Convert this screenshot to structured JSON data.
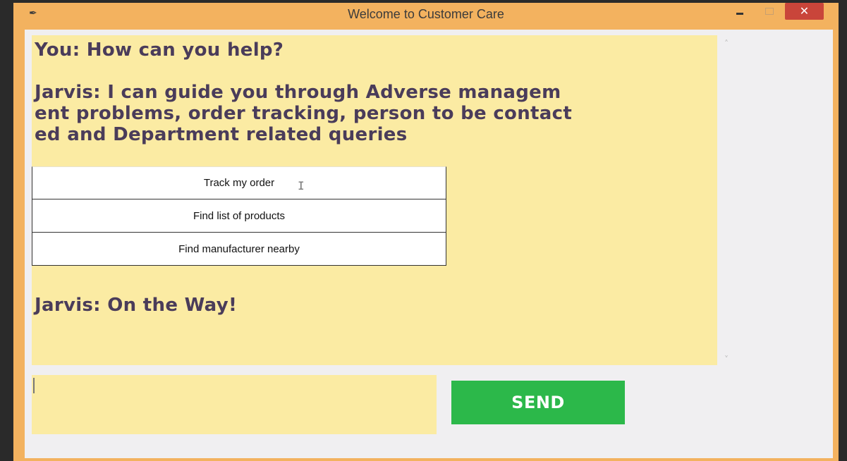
{
  "window": {
    "title": "Welcome to Customer Care",
    "app_icon": "feather-icon",
    "controls": {
      "minimize_icon": "minimize-icon",
      "maximize_icon": "maximize-icon",
      "close_icon": "close-icon",
      "close_glyph": "✕"
    }
  },
  "chat": {
    "lines": [
      "You: How can you help?",
      "Jarvis: I can guide you through Adverse managem",
      "ent problems, order tracking, person to be contact",
      "ed and Department related queries",
      "Jarvis: On the Way!"
    ],
    "options": [
      "Track my order",
      "Find list of products",
      "Find manufacturer nearby"
    ]
  },
  "composer": {
    "input_value": "",
    "send_label": "SEND"
  },
  "colors": {
    "window_frame": "#f3b25f",
    "chat_background": "#fbeba3",
    "send_button": "#2cb84a",
    "close_button": "#c9453a",
    "message_text": "#4a3c5a"
  }
}
